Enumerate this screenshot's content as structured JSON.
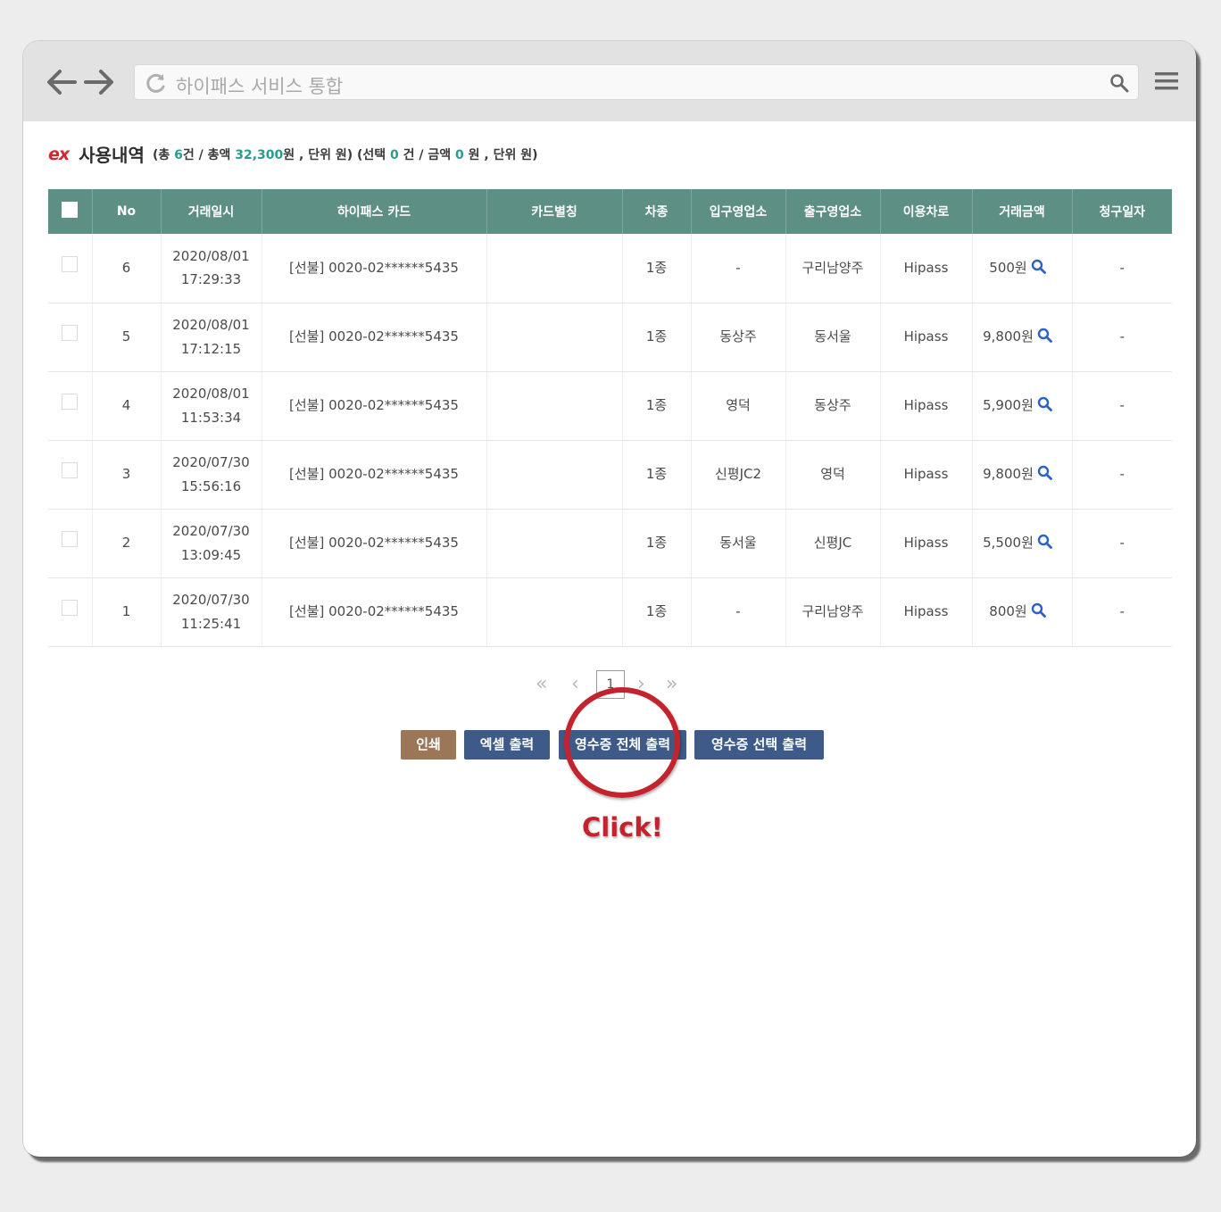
{
  "browser": {
    "address_text": "하이패스 서비스 통합"
  },
  "header": {
    "logo": "ex",
    "title": "사용내역",
    "summary_p1": "(총 ",
    "total_count": "6",
    "summary_p2": "건 / 총액 ",
    "total_amount": "32,300",
    "summary_p3": "원 , 단위 원) (선택 ",
    "selected_count": "0",
    "summary_p4": " 건 / 금액 ",
    "selected_amount": "0",
    "summary_p5": " 원 , 단위 원)"
  },
  "table": {
    "columns": [
      "No",
      "거래일시",
      "하이패스 카드",
      "카드별칭",
      "차종",
      "입구영업소",
      "출구영업소",
      "이용차로",
      "거래금액",
      "청구일자"
    ],
    "rows": [
      {
        "no": "6",
        "date": "2020/08/01",
        "time": "17:29:33",
        "card": "[선불] 0020-02******5435",
        "alias": "",
        "type": "1종",
        "entry": "-",
        "exit": "구리남양주",
        "lane": "Hipass",
        "amount": "500원",
        "billing": "-"
      },
      {
        "no": "5",
        "date": "2020/08/01",
        "time": "17:12:15",
        "card": "[선불] 0020-02******5435",
        "alias": "",
        "type": "1종",
        "entry": "동상주",
        "exit": "동서울",
        "lane": "Hipass",
        "amount": "9,800원",
        "billing": "-"
      },
      {
        "no": "4",
        "date": "2020/08/01",
        "time": "11:53:34",
        "card": "[선불] 0020-02******5435",
        "alias": "",
        "type": "1종",
        "entry": "영덕",
        "exit": "동상주",
        "lane": "Hipass",
        "amount": "5,900원",
        "billing": "-"
      },
      {
        "no": "3",
        "date": "2020/07/30",
        "time": "15:56:16",
        "card": "[선불] 0020-02******5435",
        "alias": "",
        "type": "1종",
        "entry": "신평JC2",
        "exit": "영덕",
        "lane": "Hipass",
        "amount": "9,800원",
        "billing": "-"
      },
      {
        "no": "2",
        "date": "2020/07/30",
        "time": "13:09:45",
        "card": "[선불] 0020-02******5435",
        "alias": "",
        "type": "1종",
        "entry": "동서울",
        "exit": "신평JC",
        "lane": "Hipass",
        "amount": "5,500원",
        "billing": "-"
      },
      {
        "no": "1",
        "date": "2020/07/30",
        "time": "11:25:41",
        "card": "[선불] 0020-02******5435",
        "alias": "",
        "type": "1종",
        "entry": "-",
        "exit": "구리남양주",
        "lane": "Hipass",
        "amount": "800원",
        "billing": "-"
      }
    ]
  },
  "pagination": {
    "first": "«",
    "prev": "‹",
    "current": "1",
    "next": "›",
    "last": "»"
  },
  "actions": {
    "print": "인쇄",
    "excel": "엑셀 출력",
    "receipt_all": "영수증 전체 출력",
    "receipt_selected": "영수증 선택 출력"
  },
  "annotation": {
    "click_label": "Click!"
  },
  "colors": {
    "header_green": "#5d8f84",
    "accent_teal": "#2d9a8c",
    "button_navy": "#3d5a88",
    "button_brown": "#9b7657",
    "highlight_red": "#c3232d"
  }
}
